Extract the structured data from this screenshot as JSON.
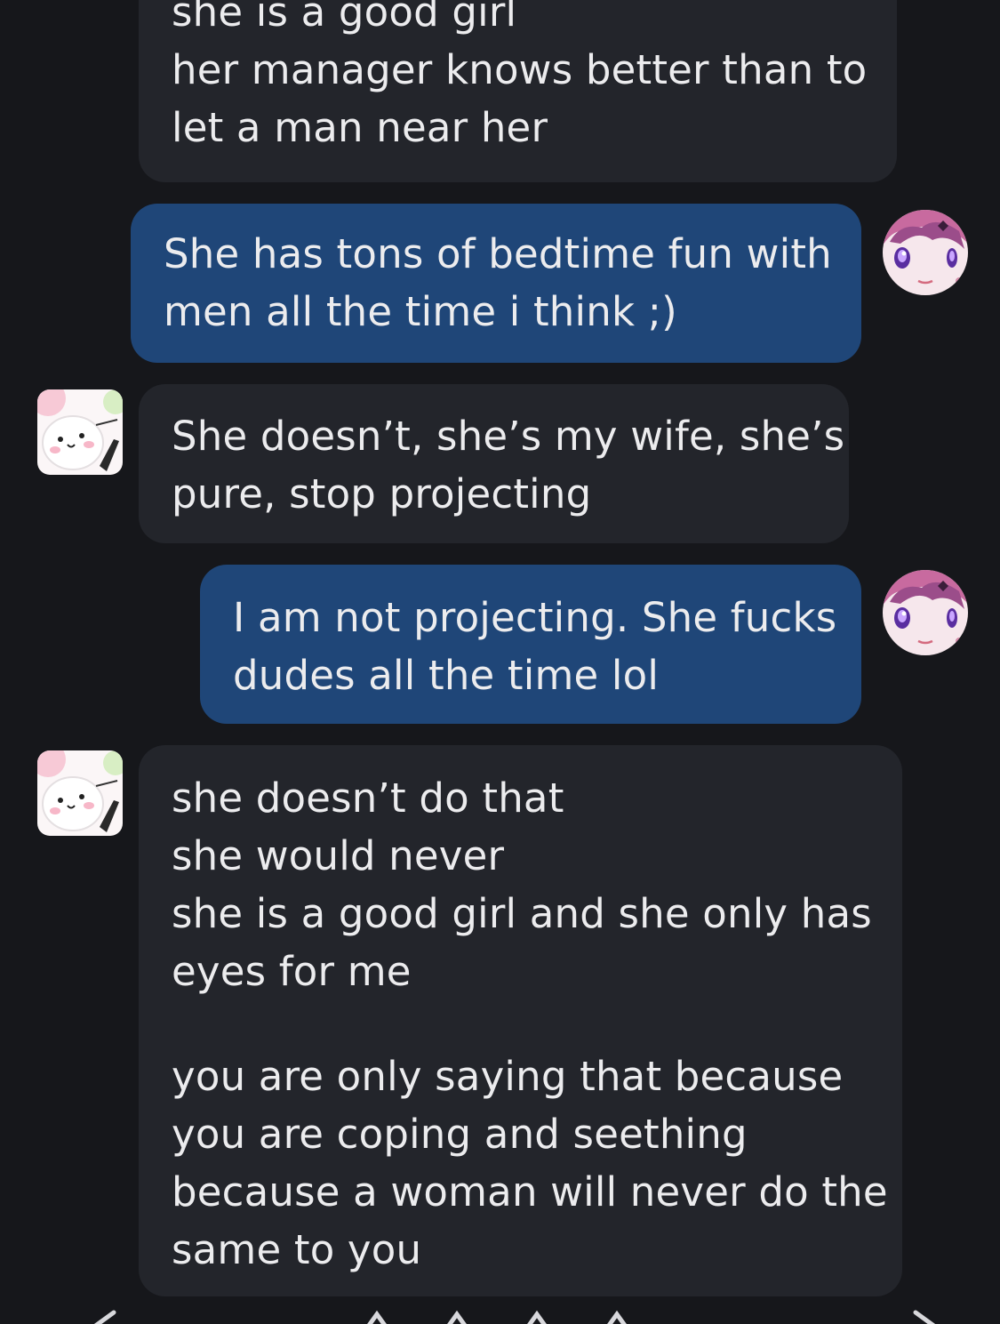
{
  "messages": [
    {
      "sender": "other",
      "lines": [
        "she is a good girl",
        "her manager knows better than to",
        "let a man near her"
      ]
    },
    {
      "sender": "self",
      "lines": [
        "She has tons of bedtime fun with",
        "men all the time i think ;)"
      ]
    },
    {
      "sender": "other",
      "lines": [
        "She doesn’t, she’s my wife, she’s",
        "pure, stop projecting"
      ]
    },
    {
      "sender": "self",
      "lines": [
        "I am not projecting. She fucks",
        "dudes all the time lol"
      ]
    },
    {
      "sender": "other",
      "paragraphs": [
        [
          "she doesn’t do that",
          "she would never",
          "she is a good girl and she only has",
          "eyes for me"
        ],
        [
          "you are only saying that because",
          "you are coping and seething",
          "because a woman will never do the",
          "same to you"
        ]
      ]
    }
  ],
  "colors": {
    "background": "#16171b",
    "received_bubble": "#23252b",
    "sent_bubble": "#1f4678",
    "text": "#ececee"
  },
  "icons": {
    "self_avatar": "anime-girl-avatar-icon",
    "other_avatar": "cartoon-cat-avatar-icon",
    "nav_back": "chevron-left-icon",
    "nav_forward": "chevron-right-icon"
  }
}
